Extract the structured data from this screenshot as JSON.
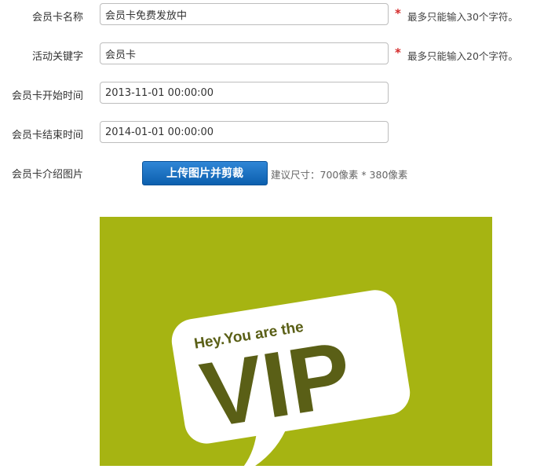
{
  "form": {
    "card_name": {
      "label": "会员卡名称",
      "value": "会员卡免费发放中",
      "required_mark": "*",
      "hint": "最多只能输入30个字符。"
    },
    "keyword": {
      "label": "活动关键字",
      "value": "会员卡",
      "required_mark": "*",
      "hint": "最多只能输入20个字符。"
    },
    "start_time": {
      "label": "会员卡开始时间",
      "value": "2013-11-01 00:00:00"
    },
    "end_time": {
      "label": "会员卡结束时间",
      "value": "2014-01-01 00:00:00"
    },
    "intro_image": {
      "label": "会员卡介绍图片",
      "upload_button": "上传图片并剪裁",
      "size_hint": "建议尺寸：700像素 * 380像素"
    }
  },
  "preview_image": {
    "small_text": "Hey.You are the",
    "big_text": "VIP",
    "background_color": "#a6b412",
    "bubble_color": "#ffffff",
    "text_color": "#5a5f16"
  }
}
